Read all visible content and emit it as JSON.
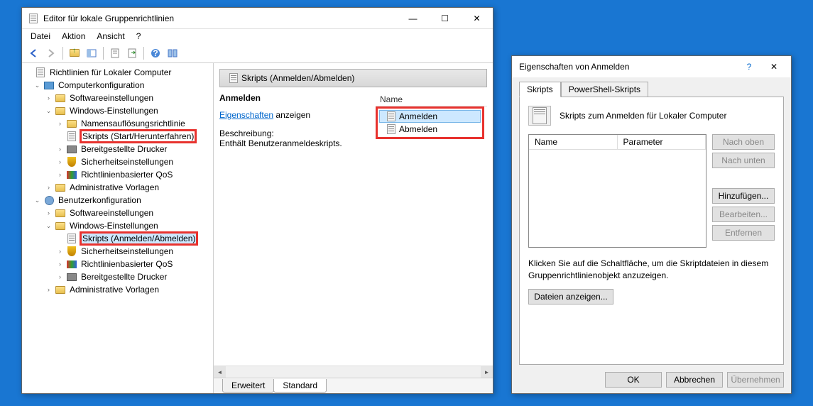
{
  "main": {
    "title": "Editor für lokale Gruppenrichtlinien",
    "menu": {
      "file": "Datei",
      "action": "Aktion",
      "view": "Ansicht",
      "help": "?"
    }
  },
  "tree": {
    "root": "Richtlinien für Lokaler Computer",
    "computer": {
      "label": "Computerkonfiguration",
      "software": "Softwareeinstellungen",
      "windows": "Windows-Einstellungen",
      "nameres": "Namensauflösungsrichtlinie",
      "scripts": "Skripts (Start/Herunterfahren)",
      "printers": "Bereitgestellte Drucker",
      "security": "Sicherheitseinstellungen",
      "qos": "Richtlinienbasierter QoS",
      "admin": "Administrative Vorlagen"
    },
    "user": {
      "label": "Benutzerkonfiguration",
      "software": "Softwareeinstellungen",
      "windows": "Windows-Einstellungen",
      "scripts": "Skripts (Anmelden/Abmelden)",
      "security": "Sicherheitseinstellungen",
      "qos": "Richtlinienbasierter QoS",
      "printers": "Bereitgestellte Drucker",
      "admin": "Administrative Vorlagen"
    }
  },
  "detail": {
    "header": "Skripts (Anmelden/Abmelden)",
    "section": "Anmelden",
    "props_link": "Eigenschaften",
    "props_suffix": " anzeigen",
    "desc_label": "Beschreibung:",
    "desc_text": "Enthält Benutzeranmeldeskripts.",
    "colname": "Name",
    "items": {
      "login": "Anmelden",
      "logout": "Abmelden"
    },
    "tabs": {
      "ext": "Erweitert",
      "std": "Standard"
    }
  },
  "dialog": {
    "title": "Eigenschaften von Anmelden",
    "tabs": {
      "scripts": "Skripts",
      "ps": "PowerShell-Skripts"
    },
    "desc": "Skripts zum Anmelden für Lokaler Computer",
    "cols": {
      "name": "Name",
      "param": "Parameter"
    },
    "btns": {
      "up": "Nach oben",
      "down": "Nach unten",
      "add": "Hinzufügen...",
      "edit": "Bearbeiten...",
      "remove": "Entfernen"
    },
    "hint": "Klicken Sie auf die Schaltfläche, um die Skriptdateien in diesem Gruppenrichtlinienobjekt anzuzeigen.",
    "files_btn": "Dateien anzeigen...",
    "actions": {
      "ok": "OK",
      "cancel": "Abbrechen",
      "apply": "Übernehmen"
    },
    "help": "?"
  }
}
